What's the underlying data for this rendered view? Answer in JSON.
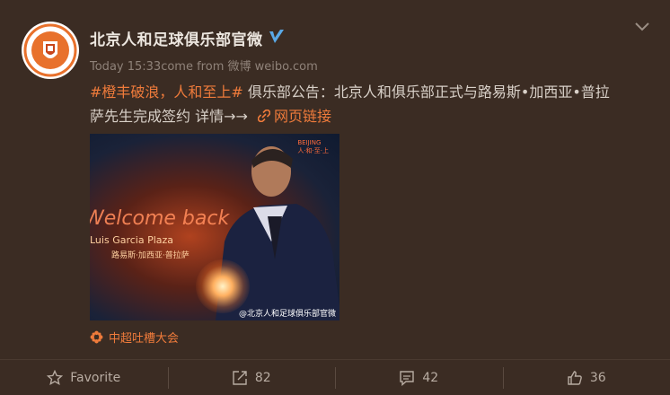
{
  "post": {
    "author": "北京人和足球俱乐部官微",
    "time": "Today 15:33",
    "source_prefix": "come from",
    "source": "微博 weibo.com",
    "hashtag": "#橙丰破浪，人和至上#",
    "text_line1": " 俱乐部公告：北京人和俱乐部正式与路易斯•加西亚•普拉",
    "text_line2": "萨先生完成签约    详情→→ ",
    "link_label": "网页链接",
    "topic": "中超吐槽大会"
  },
  "photo": {
    "corner_logo_line1": "BEIJING",
    "corner_logo_line2": "人·和·至·上",
    "welcome": "Welcome back",
    "name_en": "Luis Garcia Plaza",
    "name_cn": "路易斯·加西亚·普拉萨",
    "watermark": "@北京人和足球俱乐部官微"
  },
  "actions": {
    "favorite": "Favorite",
    "repost": "82",
    "comment": "42",
    "like": "36"
  },
  "colors": {
    "background": "#3b2c23",
    "accent": "#ef7b3b",
    "verified": "#5aa9e6"
  }
}
